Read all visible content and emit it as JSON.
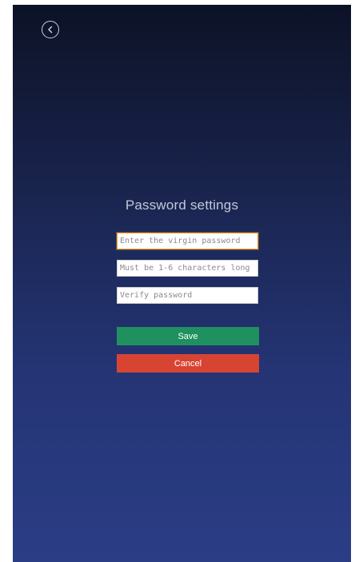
{
  "header": {
    "back_icon": "chevron-left-circle-icon"
  },
  "page": {
    "title": "Password settings"
  },
  "form": {
    "virgin_password_placeholder": "Enter the virgin password",
    "new_password_placeholder": "Must be 1-6 characters long",
    "verify_password_placeholder": "Verify password",
    "save_label": "Save",
    "cancel_label": "Cancel"
  },
  "colors": {
    "background_top": "#0c1226",
    "background_bottom": "#2b3d85",
    "save_button": "#1f915f",
    "cancel_button": "#d84432",
    "focus_border": "#e89a2b"
  }
}
